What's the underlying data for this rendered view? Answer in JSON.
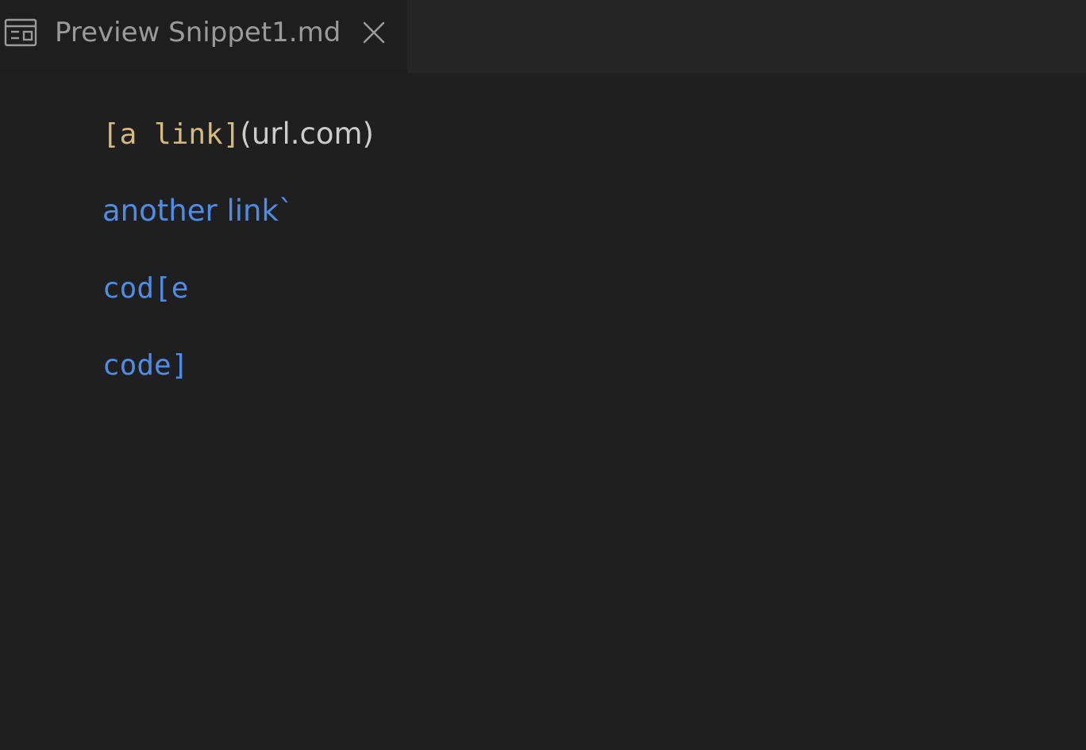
{
  "colors": {
    "background": "#1f1f1f",
    "tab_active_bg": "#1e1e1e",
    "tabbar_bg": "#252526",
    "tab_text": "#9a9a9a",
    "code": "#d7ba7d",
    "text": "#cccccc",
    "link": "#4d8de8"
  },
  "tab": {
    "icon": "open-preview-icon",
    "label": "Preview Snippet1.md",
    "close_icon": "close-icon"
  },
  "preview": {
    "line1": {
      "code": "[a link]",
      "text": "(url.com)"
    },
    "line2": {
      "link_text": "another link`"
    },
    "line3": {
      "link_code": "cod[e"
    },
    "line4": {
      "link_code": "code]"
    }
  }
}
